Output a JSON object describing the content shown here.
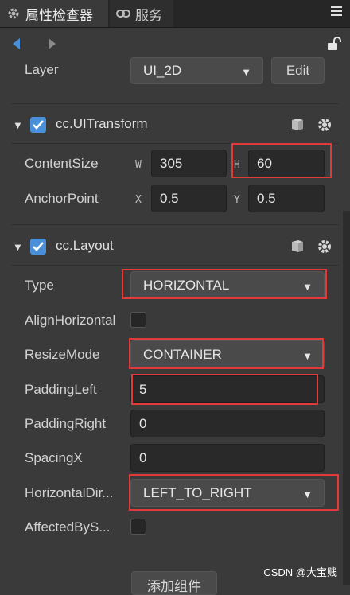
{
  "tabs": [
    {
      "label": "属性检查器",
      "icon": "gear-icon"
    },
    {
      "label": "服务",
      "icon": "link-icon"
    }
  ],
  "menu_icon": "hamburger-menu-icon",
  "layer": {
    "label": "Layer",
    "value": "UI_2D",
    "edit_label": "Edit"
  },
  "uitransform": {
    "title": "cc.UITransform",
    "content_size": {
      "label": "ContentSize",
      "w_label": "W",
      "w": "305",
      "h_label": "H",
      "h": "60"
    },
    "anchor_point": {
      "label": "AnchorPoint",
      "x_label": "X",
      "x": "0.5",
      "y_label": "Y",
      "y": "0.5"
    }
  },
  "layout": {
    "title": "cc.Layout",
    "type": {
      "label": "Type",
      "value": "HORIZONTAL"
    },
    "align_horizontal": {
      "label": "AlignHorizontal"
    },
    "resize_mode": {
      "label": "ResizeMode",
      "value": "CONTAINER"
    },
    "padding_left": {
      "label": "PaddingLeft",
      "value": "5"
    },
    "padding_right": {
      "label": "PaddingRight",
      "value": "0"
    },
    "spacing_x": {
      "label": "SpacingX",
      "value": "0"
    },
    "horizontal_direction": {
      "label": "HorizontalDir...",
      "value": "LEFT_TO_RIGHT"
    },
    "affected_by_scale": {
      "label": "AffectedByS..."
    }
  },
  "add_component_label": "添加组件",
  "watermark": "CSDN @大宝贱",
  "colors": {
    "accent": "#4a90d9",
    "highlight": "#e03a3a",
    "background": "#3a3a3a"
  }
}
